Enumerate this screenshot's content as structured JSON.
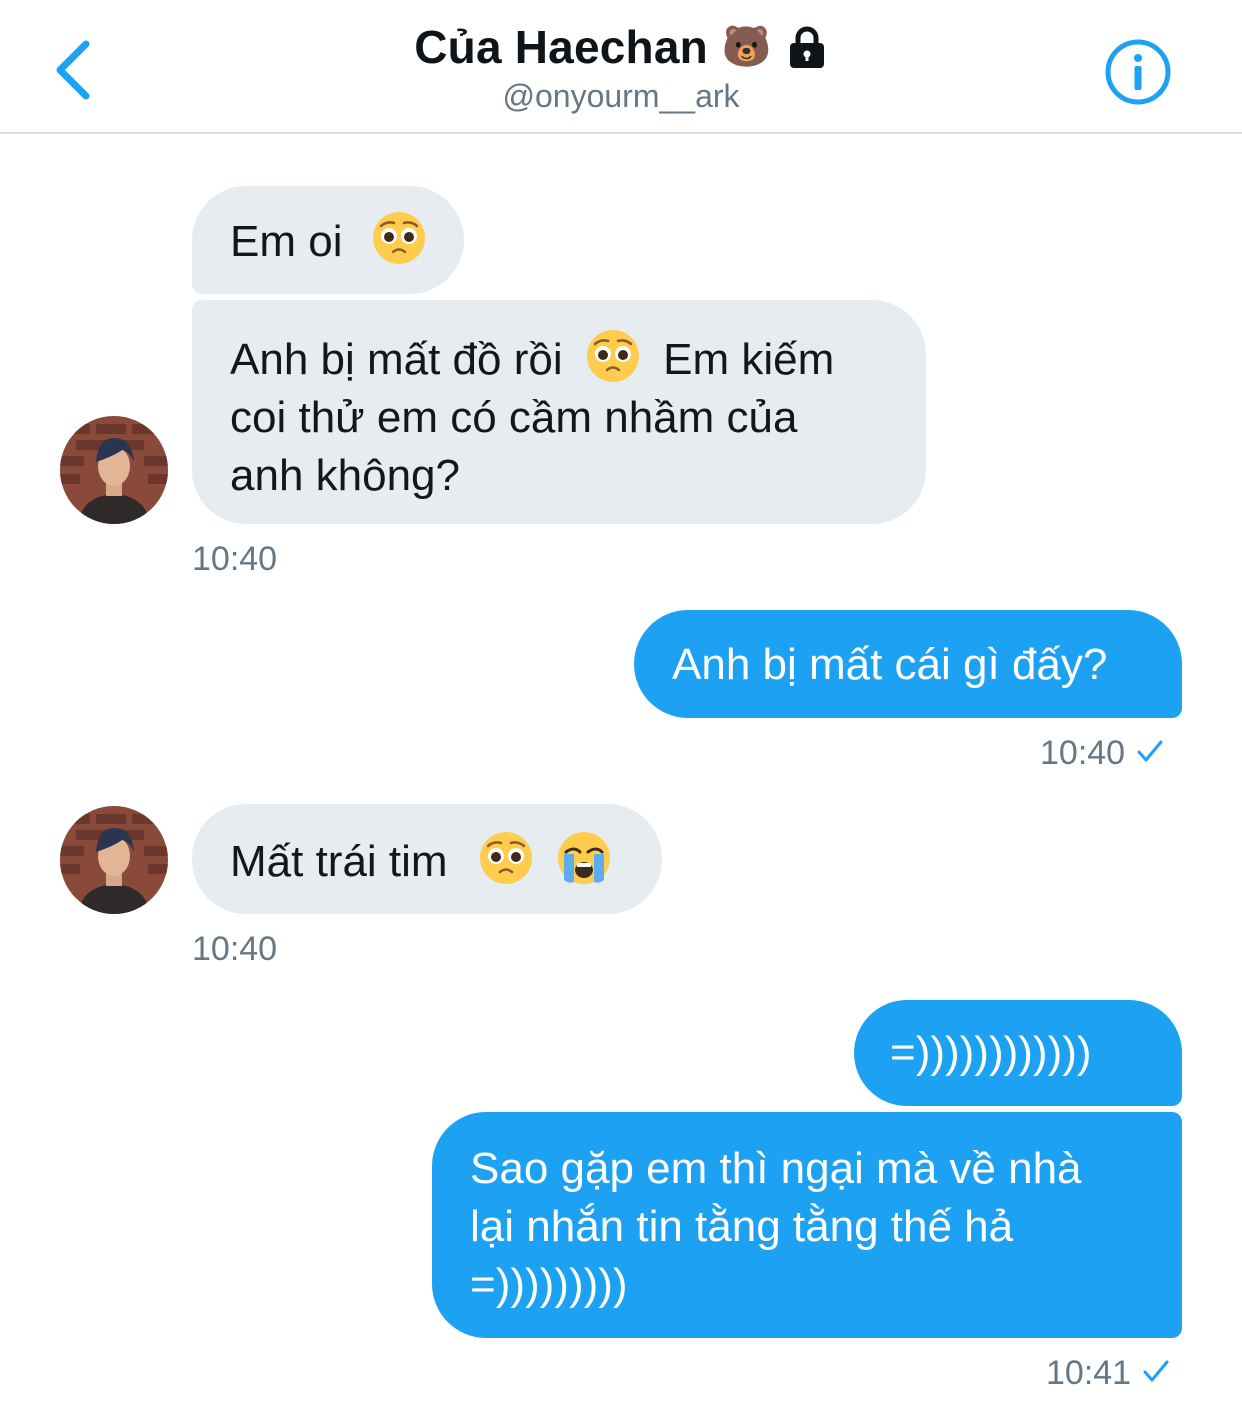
{
  "header": {
    "title": "Của Haechan",
    "bear_emoji": "🐻",
    "handle": "@onyourm__ark"
  },
  "icons": {
    "back": "chevron-left-icon",
    "lock": "lock-icon",
    "info": "info-icon",
    "avatar": "avatar",
    "pleading": "pleading-face-emoji",
    "crying": "loudly-crying-face-emoji",
    "check": "check-icon"
  },
  "colors": {
    "accent": "#1da1f2",
    "incoming_bubble": "#e6ecf0",
    "text_dark": "#14171a",
    "muted": "#657786"
  },
  "messages": [
    {
      "direction": "in",
      "text": "Em oi"
    },
    {
      "direction": "in",
      "text_part1": "Anh bị mất đồ rồi",
      "text_part2": "Em kiếm",
      "text_line2": "coi thử em có cầm nhầm của",
      "text_line3": "anh không?"
    },
    {
      "direction": "in",
      "time": "10:40"
    },
    {
      "direction": "out",
      "text": "Anh bị mất cái gì đấy?",
      "time": "10:40"
    },
    {
      "direction": "in",
      "text": "Mất trái tim",
      "time": "10:40"
    },
    {
      "direction": "out",
      "text": "=))))))))))))"
    },
    {
      "direction": "out",
      "line1": "Sao gặp em thì ngại mà về nhà",
      "line2": "lại nhắn tin tằng tằng thế hả",
      "line3": "=)))))))))",
      "time": "10:41"
    }
  ]
}
